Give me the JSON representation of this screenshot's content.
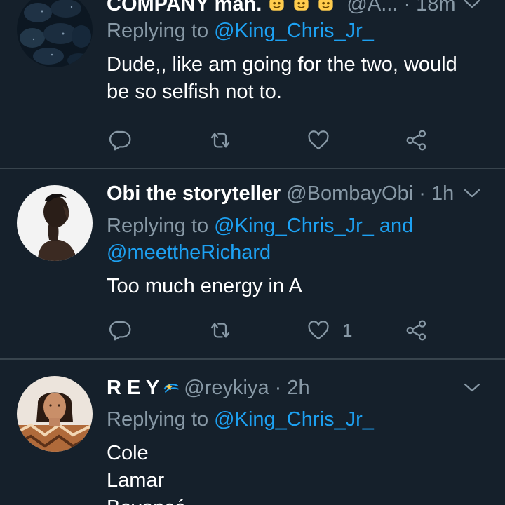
{
  "tweets": [
    {
      "name": "COMPANY man.",
      "handle": "@A...",
      "time": "· 18m",
      "reply_prefix": "Replying to",
      "mentions": [
        "@King_Chris_Jr_"
      ],
      "text_lines": [
        "Dude,,  like am going for the two, would",
        "be so selfish not to."
      ],
      "like_count": ""
    },
    {
      "name": "Obi the storyteller",
      "handle": "@BombayObi",
      "time": "· 1h",
      "reply_prefix": "Replying to",
      "mentions": [
        "@King_Chris_Jr_",
        "@meettheRichard"
      ],
      "mention_joiner": "and",
      "text_lines": [
        "Too much energy in A"
      ],
      "like_count": "1"
    },
    {
      "name": "R E Y",
      "handle": "@reykiya",
      "time": "· 2h",
      "reply_prefix": "Replying to",
      "mentions": [
        "@King_Chris_Jr_"
      ],
      "text_lines": [
        "Cole",
        "Lamar",
        "Beyoncé"
      ]
    }
  ],
  "icons": {
    "reply": "reply-icon",
    "retweet": "retweet-icon",
    "like": "heart-icon",
    "share": "share-icon",
    "more": "chevron-down-icon",
    "name_emoji": "cookie-emoji",
    "name_sparkle": "dizzy-sparkle-emoji"
  },
  "colors": {
    "background": "#15202b",
    "text": "#ffffff",
    "muted": "#8899a6",
    "link": "#1da1f2",
    "divider": "#38444d"
  }
}
